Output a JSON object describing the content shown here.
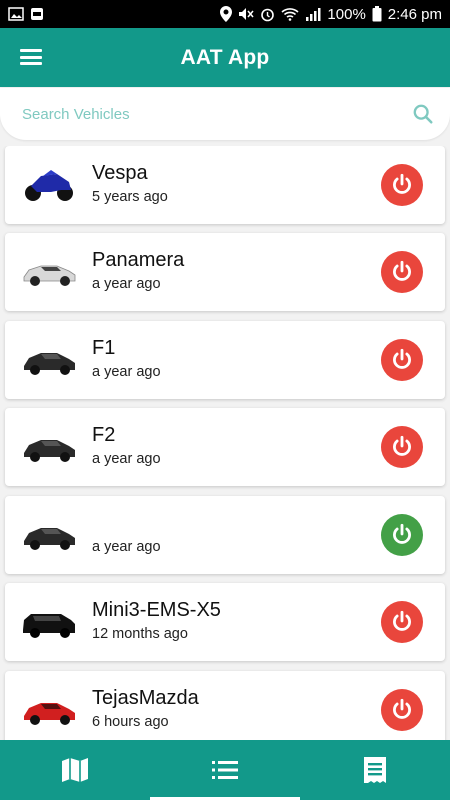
{
  "status_bar": {
    "battery": "100%",
    "time": "2:46 pm",
    "icons": [
      "image-icon",
      "notification-icon",
      "location-icon",
      "mute-icon",
      "alarm-icon",
      "wifi-icon",
      "signal-icon",
      "battery-icon"
    ]
  },
  "app_bar": {
    "title": "AAT App",
    "menu_icon": "menu-icon"
  },
  "search": {
    "placeholder": "Search Vehicles",
    "value": "",
    "icon": "search-icon"
  },
  "vehicles": [
    {
      "name": "Vespa",
      "time": "5 years ago",
      "type": "motorcycle",
      "color": "#1f2aa8",
      "power": "off"
    },
    {
      "name": "Panamera",
      "time": "a year ago",
      "type": "sedan",
      "color": "#d8d8d8",
      "power": "off"
    },
    {
      "name": "F1",
      "time": "a year ago",
      "type": "sedan",
      "color": "#2a2a2a",
      "power": "off"
    },
    {
      "name": "F2",
      "time": "a year ago",
      "type": "sedan",
      "color": "#2a2a2a",
      "power": "off"
    },
    {
      "name": "",
      "time": "a year ago",
      "type": "sedan",
      "color": "#2a2a2a",
      "power": "on"
    },
    {
      "name": "Mini3-EMS-X5",
      "time": "12 months ago",
      "type": "suv",
      "color": "#111111",
      "power": "off"
    },
    {
      "name": "TejasMazda",
      "time": "6 hours ago",
      "type": "sedan",
      "color": "#d11f1f",
      "power": "off"
    }
  ],
  "colors": {
    "primary": "#12998a",
    "power_off": "#e9463c",
    "power_on": "#43a047",
    "search_placeholder": "#7fc9c0"
  },
  "bottom_nav": {
    "tabs": [
      {
        "name": "map",
        "icon": "map-icon"
      },
      {
        "name": "list",
        "icon": "list-icon",
        "active": true
      },
      {
        "name": "reports",
        "icon": "receipt-icon"
      }
    ]
  }
}
